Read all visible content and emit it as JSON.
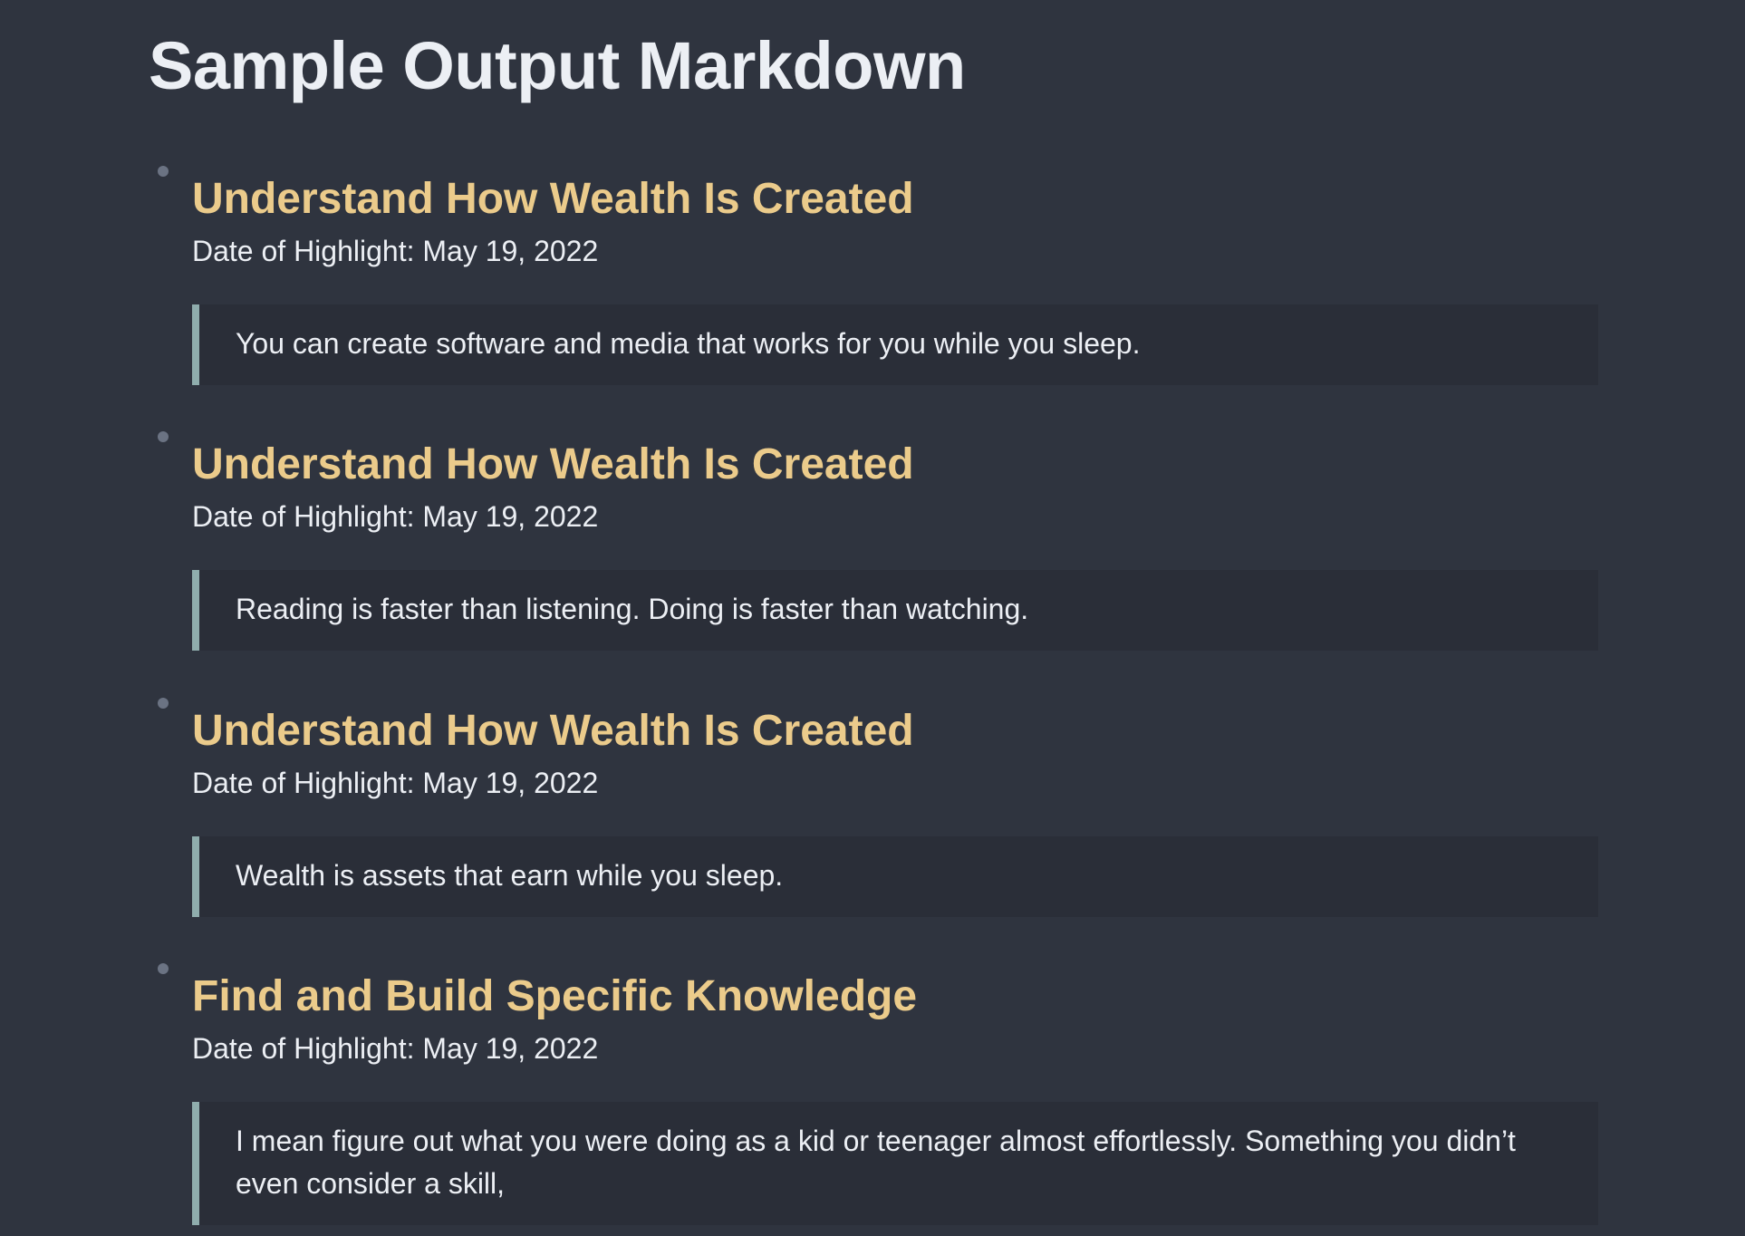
{
  "page": {
    "title": "Sample Output Markdown"
  },
  "highlights": [
    {
      "chapter": "Understand How Wealth Is Created",
      "date_label": "Date of Highlight: May 19, 2022",
      "quote": "You can create software and media that works for you while you sleep."
    },
    {
      "chapter": "Understand How Wealth Is Created",
      "date_label": "Date of Highlight: May 19, 2022",
      "quote": "Reading is faster than listening. Doing is faster than watching."
    },
    {
      "chapter": "Understand How Wealth Is Created",
      "date_label": "Date of Highlight: May 19, 2022",
      "quote": "Wealth is assets that earn while you sleep."
    },
    {
      "chapter": "Find and Build Specific Knowledge",
      "date_label": "Date of Highlight: May 19, 2022",
      "quote": "I mean figure out what you were doing as a kid or teenager almost effortlessly. Something you didn’t even consider a skill,"
    }
  ],
  "colors": {
    "background": "#2f343f",
    "heading": "#eceff4",
    "chapter_title": "#ebcb8b",
    "quote_background": "#2a2e38",
    "quote_border": "#8fadad",
    "bullet": "#6b7383"
  }
}
